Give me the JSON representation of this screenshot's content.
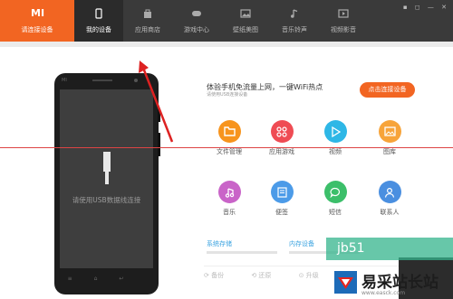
{
  "brand": {
    "logo": "MI",
    "label": "请连接设备",
    "color": "#f26522"
  },
  "tabs": [
    {
      "label": "我的设备",
      "icon": "phone-icon",
      "active": true
    },
    {
      "label": "应用商店",
      "icon": "bag-icon"
    },
    {
      "label": "游戏中心",
      "icon": "gamepad-icon"
    },
    {
      "label": "壁纸美图",
      "icon": "image-icon"
    },
    {
      "label": "音乐铃声",
      "icon": "music-icon"
    },
    {
      "label": "视频影音",
      "icon": "video-icon"
    }
  ],
  "window_controls": "▪ ◻ — ✕",
  "phone": {
    "brand": "MI",
    "hint": "请使用USB数据线连接"
  },
  "promo": {
    "title": "体验手机免流量上网，一键WiFi热点",
    "subtitle": "请使用USB连接设备",
    "button": "点击连接设备"
  },
  "apps": [
    {
      "label": "文件管理",
      "icon": "folder-icon",
      "color": "#f7941d"
    },
    {
      "label": "应用游戏",
      "icon": "grid-icon",
      "color": "#ef4c54"
    },
    {
      "label": "视频",
      "icon": "play-icon",
      "color": "#2eb7e6"
    },
    {
      "label": "图库",
      "icon": "picture-icon",
      "color": "#f7a43a"
    },
    {
      "label": "音乐",
      "icon": "music-icon",
      "color": "#c964c8"
    },
    {
      "label": "便签",
      "icon": "note-icon",
      "color": "#4c9be8"
    },
    {
      "label": "短信",
      "icon": "chat-icon",
      "color": "#3cbf6a"
    },
    {
      "label": "联系人",
      "icon": "person-icon",
      "color": "#4a8fe0"
    }
  ],
  "storage": {
    "system": "系统存储",
    "internal": "内存设备"
  },
  "bottom_actions": [
    "备份",
    "还原",
    "升级"
  ],
  "watermark": {
    "cn": "易采站长站",
    "url": "www.easck.com",
    "partial": "jb51"
  }
}
